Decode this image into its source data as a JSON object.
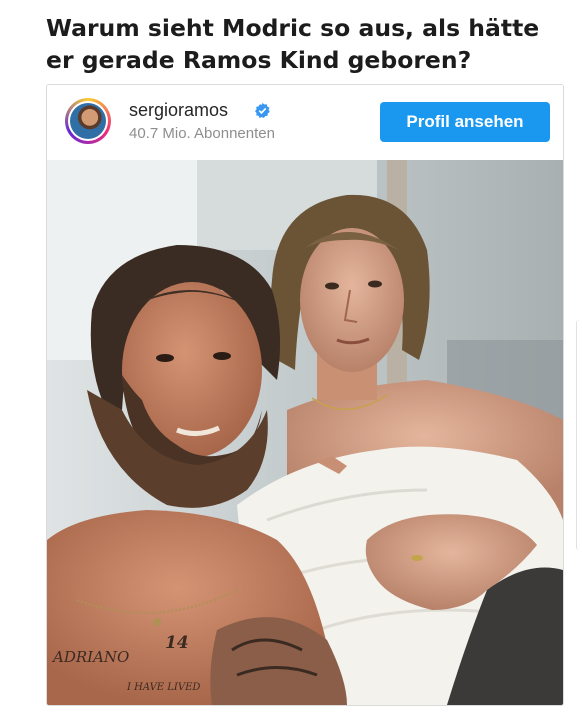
{
  "post": {
    "headline": "Warum sieht Modric so aus, als hätte er gerade Ramos Kind geboren?"
  },
  "embed": {
    "username": "sergioramos",
    "followers": "40.7 Mio. Abonnenten",
    "profile_button": "Profil ansehen",
    "verified": true,
    "accent_color": "#1a98f0",
    "photo_tattoo_text_1": "ADRIANO",
    "photo_tattoo_text_2": "14",
    "photo_tattoo_text_3": "I HAVE LIVED"
  }
}
